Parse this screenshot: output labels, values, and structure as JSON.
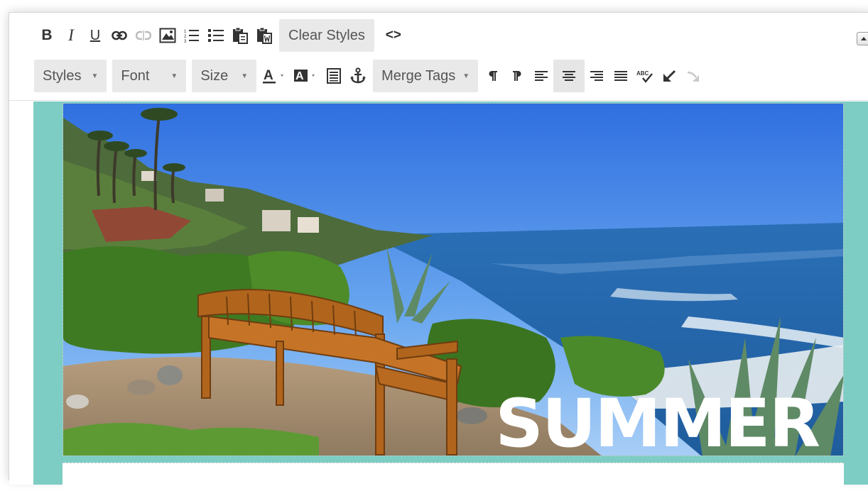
{
  "toolbar": {
    "row1": {
      "bold": "B",
      "italic": "I",
      "underline": "U",
      "clear_styles": "Clear Styles",
      "source": "<>"
    },
    "row2": {
      "styles": "Styles",
      "font": "Font",
      "size": "Size",
      "merge_tags": "Merge Tags"
    }
  },
  "content": {
    "image_caption": "SUMMER"
  },
  "colors": {
    "teal_background": "#7ecdc4",
    "button_gray": "#e9e9e9"
  }
}
